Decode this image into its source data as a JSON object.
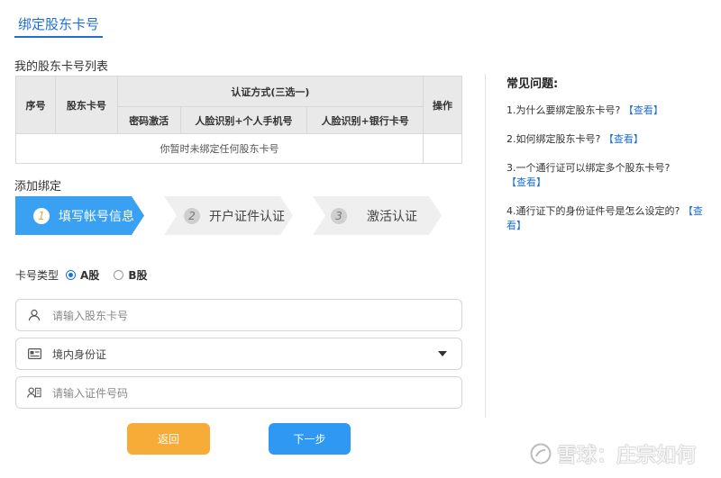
{
  "tab": {
    "label": "绑定股东卡号"
  },
  "list": {
    "title": "我的股东卡号列表",
    "headers": {
      "seq": "序号",
      "card": "股东卡号",
      "auth_group": "认证方式(三选一)",
      "action": "操作",
      "sub": [
        "密码激活",
        "人脸识别+个人手机号",
        "人脸识别+银行卡号"
      ]
    },
    "empty_text": "你暂时未绑定任何股东卡号"
  },
  "add": {
    "title": "添加绑定",
    "steps": [
      {
        "num": "1",
        "label": "填写帐号信息"
      },
      {
        "num": "2",
        "label": "开户证件认证"
      },
      {
        "num": "3",
        "label": "激活认证"
      }
    ]
  },
  "form": {
    "card_type_label": "卡号类型",
    "options": [
      "A股",
      "B股"
    ],
    "selected_option": "A股",
    "card_placeholder": "请输入股东卡号",
    "id_type_value": "境内身份证",
    "id_placeholder": "请输入证件号码"
  },
  "buttons": {
    "back": "返回",
    "next": "下一步"
  },
  "faq": {
    "title": "常见问题:",
    "items": [
      {
        "q": "1.为什么要绑定股东卡号?",
        "link": "【查看】"
      },
      {
        "q": "2.如何绑定股东卡号?",
        "link": "【查看】"
      },
      {
        "q": "3.一个通行证可以绑定多个股东卡号?",
        "link": "【查看】"
      },
      {
        "q": "4.通行证下的身份证件号是怎么设定的?",
        "link": "【查看】"
      }
    ]
  },
  "watermark": "雪球：庄宗如何",
  "colors": {
    "accent": "#1f6fd6",
    "step_active": "#3aa0f2",
    "back_btn": "#f8ac38",
    "next_btn": "#2f98f2"
  }
}
